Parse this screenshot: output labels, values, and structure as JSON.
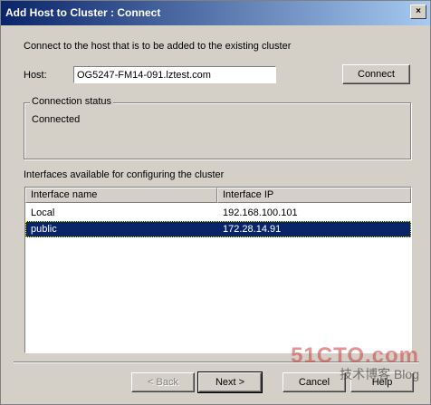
{
  "window": {
    "title": "Add Host to Cluster : Connect",
    "close_glyph": "×"
  },
  "intro": "Connect to the host that is to be added to the existing cluster",
  "host": {
    "label": "Host:",
    "value": "OG5247-FM14-091.lztest.com",
    "connect_label": "Connect"
  },
  "connection_status": {
    "legend": "Connection status",
    "status": "Connected"
  },
  "interfaces": {
    "caption": "Interfaces available for configuring the cluster",
    "columns": [
      "Interface name",
      "Interface IP"
    ],
    "rows": [
      {
        "name": "Local",
        "ip": "192.168.100.101",
        "selected": false
      },
      {
        "name": "public",
        "ip": "172.28.14.91",
        "selected": true
      }
    ]
  },
  "footer": {
    "back_label": "< Back",
    "next_label": "Next >",
    "cancel_label": "Cancel",
    "help_label": "Help"
  },
  "watermark": {
    "line1": "51CTO.com",
    "line2": "技术博客 Blog"
  },
  "colors": {
    "title_gradient_start": "#0a246a",
    "title_gradient_end": "#a6caf0",
    "selection": "#0a246a",
    "dialog_bg": "#d4d0c8"
  }
}
